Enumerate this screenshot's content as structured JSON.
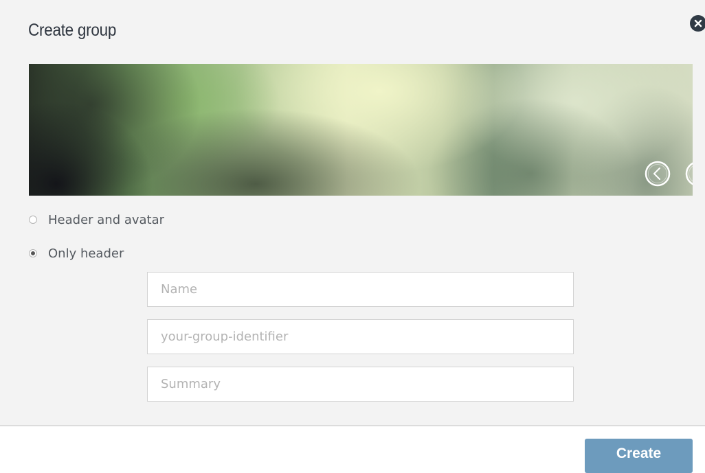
{
  "dialog": {
    "title": "Create group",
    "close_icon": "close-icon"
  },
  "banner": {
    "prev_icon": "chevron-left-circle-icon",
    "next_icon": "chevron-right-circle-icon"
  },
  "layout_options": [
    {
      "label": "Header and avatar",
      "checked": false
    },
    {
      "label": "Only header",
      "checked": true
    }
  ],
  "fields": {
    "name": {
      "value": "",
      "placeholder": "Name"
    },
    "identifier": {
      "value": "",
      "placeholder": "your-group-identifier"
    },
    "summary": {
      "value": "",
      "placeholder": "Summary"
    }
  },
  "actions": {
    "create_label": "Create"
  },
  "colors": {
    "panel_bg": "#f3f3f3",
    "primary_button": "#6d9bbd",
    "title_text": "#2f3640",
    "close_bg": "#303a45"
  }
}
